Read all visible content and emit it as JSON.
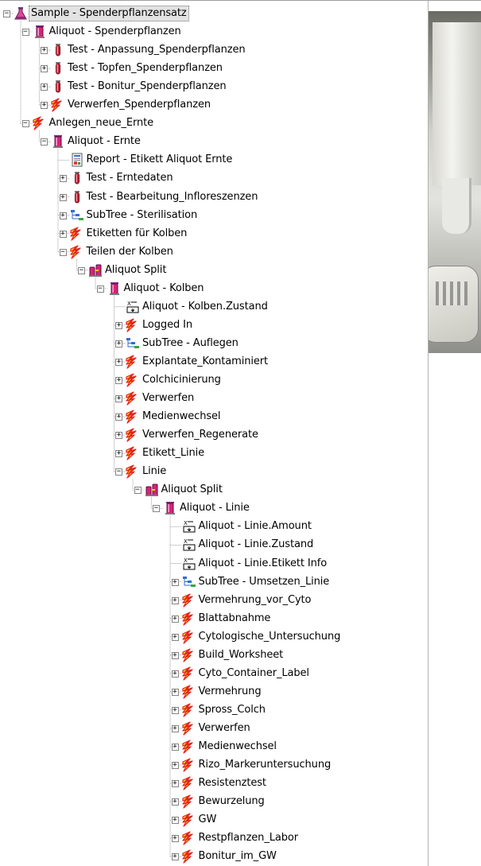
{
  "tree": {
    "root_label": "Sample - Spenderpflanzensatz",
    "nodes": [
      {
        "label": "Sample - Spenderpflanzensatz",
        "level": 0,
        "icon": "sample-flask-icon",
        "toggle": "minus"
      },
      {
        "label": "Aliquot - Spenderpflanzen",
        "level": 1,
        "icon": "aliquot-tube-icon",
        "toggle": "minus"
      },
      {
        "label": "Test - Anpassung_Spenderpflanzen",
        "level": 2,
        "icon": "test-tube-icon",
        "toggle": "plus"
      },
      {
        "label": "Test - Topfen_Spenderpflanzen",
        "level": 2,
        "icon": "test-tube-icon",
        "toggle": "plus"
      },
      {
        "label": "Test - Bonitur_Spenderpflanzen",
        "level": 2,
        "icon": "test-tube-icon",
        "toggle": "plus"
      },
      {
        "label": "Verwerfen_Spenderpflanzen",
        "level": 2,
        "icon": "lightning-icon",
        "toggle": "plus"
      },
      {
        "label": "Anlegen_neue_Ernte",
        "level": 1,
        "icon": "lightning-icon",
        "toggle": "minus"
      },
      {
        "label": "Aliquot - Ernte",
        "level": 2,
        "icon": "aliquot-tube-icon",
        "toggle": "minus"
      },
      {
        "label": "Report - Etikett Aliquot Ernte",
        "level": 3,
        "icon": "report-icon",
        "toggle": "none"
      },
      {
        "label": "Test - Erntedaten",
        "level": 3,
        "icon": "test-tube-icon",
        "toggle": "plus"
      },
      {
        "label": "Test - Bearbeitung_Infloreszenzen",
        "level": 3,
        "icon": "test-tube-icon",
        "toggle": "plus"
      },
      {
        "label": "SubTree - Sterilisation",
        "level": 3,
        "icon": "subtree-icon",
        "toggle": "plus"
      },
      {
        "label": "Etiketten für Kolben",
        "level": 3,
        "icon": "lightning-icon",
        "toggle": "plus"
      },
      {
        "label": "Teilen der Kolben",
        "level": 3,
        "icon": "lightning-icon",
        "toggle": "minus"
      },
      {
        "label": "Aliquot Split",
        "level": 4,
        "icon": "aliquot-split-icon",
        "toggle": "minus"
      },
      {
        "label": "Aliquot - Kolben",
        "level": 5,
        "icon": "aliquot-tube-icon",
        "toggle": "minus"
      },
      {
        "label": "Aliquot - Kolben.Zustand",
        "level": 6,
        "icon": "field-icon",
        "toggle": "none"
      },
      {
        "label": "Logged In",
        "level": 6,
        "icon": "lightning-icon",
        "toggle": "plus"
      },
      {
        "label": "SubTree - Auflegen",
        "level": 6,
        "icon": "subtree-icon",
        "toggle": "plus"
      },
      {
        "label": "Explantate_Kontaminiert",
        "level": 6,
        "icon": "lightning-icon",
        "toggle": "plus"
      },
      {
        "label": "Colchicinierung",
        "level": 6,
        "icon": "lightning-icon",
        "toggle": "plus"
      },
      {
        "label": "Verwerfen",
        "level": 6,
        "icon": "lightning-icon",
        "toggle": "plus"
      },
      {
        "label": "Medienwechsel",
        "level": 6,
        "icon": "lightning-icon",
        "toggle": "plus"
      },
      {
        "label": "Verwerfen_Regenerate",
        "level": 6,
        "icon": "lightning-icon",
        "toggle": "plus"
      },
      {
        "label": "Etikett_Linie",
        "level": 6,
        "icon": "lightning-icon",
        "toggle": "plus"
      },
      {
        "label": "Linie",
        "level": 6,
        "icon": "lightning-icon",
        "toggle": "minus"
      },
      {
        "label": "Aliquot Split",
        "level": 7,
        "icon": "aliquot-split-icon",
        "toggle": "minus"
      },
      {
        "label": "Aliquot - Linie",
        "level": 8,
        "icon": "aliquot-tube-icon",
        "toggle": "minus"
      },
      {
        "label": "Aliquot - Linie.Amount",
        "level": 9,
        "icon": "field-icon",
        "toggle": "none"
      },
      {
        "label": "Aliquot - Linie.Zustand",
        "level": 9,
        "icon": "field-icon",
        "toggle": "none"
      },
      {
        "label": "Aliquot - Linie.Etikett Info",
        "level": 9,
        "icon": "field-icon",
        "toggle": "none"
      },
      {
        "label": "SubTree - Umsetzen_Linie",
        "level": 9,
        "icon": "subtree-icon",
        "toggle": "plus"
      },
      {
        "label": "Vermehrung_vor_Cyto",
        "level": 9,
        "icon": "lightning-icon",
        "toggle": "plus"
      },
      {
        "label": "Blattabnahme",
        "level": 9,
        "icon": "lightning-icon",
        "toggle": "plus"
      },
      {
        "label": "Cytologische_Untersuchung",
        "level": 9,
        "icon": "lightning-icon",
        "toggle": "plus"
      },
      {
        "label": "Build_Worksheet",
        "level": 9,
        "icon": "lightning-icon",
        "toggle": "plus"
      },
      {
        "label": "Cyto_Container_Label",
        "level": 9,
        "icon": "lightning-icon",
        "toggle": "plus"
      },
      {
        "label": "Vermehrung",
        "level": 9,
        "icon": "lightning-icon",
        "toggle": "plus"
      },
      {
        "label": "Spross_Colch",
        "level": 9,
        "icon": "lightning-icon",
        "toggle": "plus"
      },
      {
        "label": "Verwerfen",
        "level": 9,
        "icon": "lightning-icon",
        "toggle": "plus"
      },
      {
        "label": "Medienwechsel",
        "level": 9,
        "icon": "lightning-icon",
        "toggle": "plus"
      },
      {
        "label": "Rizo_Markeruntersuchung",
        "level": 9,
        "icon": "lightning-icon",
        "toggle": "plus"
      },
      {
        "label": "Resistenztest",
        "level": 9,
        "icon": "lightning-icon",
        "toggle": "plus"
      },
      {
        "label": "Bewurzelung",
        "level": 9,
        "icon": "lightning-icon",
        "toggle": "plus"
      },
      {
        "label": "GW",
        "level": 9,
        "icon": "lightning-icon",
        "toggle": "plus"
      },
      {
        "label": "Restpflanzen_Labor",
        "level": 9,
        "icon": "lightning-icon",
        "toggle": "plus"
      },
      {
        "label": "Bonitur_im_GW",
        "level": 9,
        "icon": "lightning-icon",
        "toggle": "plus"
      }
    ]
  },
  "colors": {
    "selection_bg": "#e3e3e3",
    "tree_line": "#a0a0a0",
    "toggle_border": "#848484",
    "lightning_red": "#e5231b",
    "lightning_yellow": "#f7d21b",
    "tube_red": "#c8283a",
    "flask_pink": "#e0449a"
  }
}
